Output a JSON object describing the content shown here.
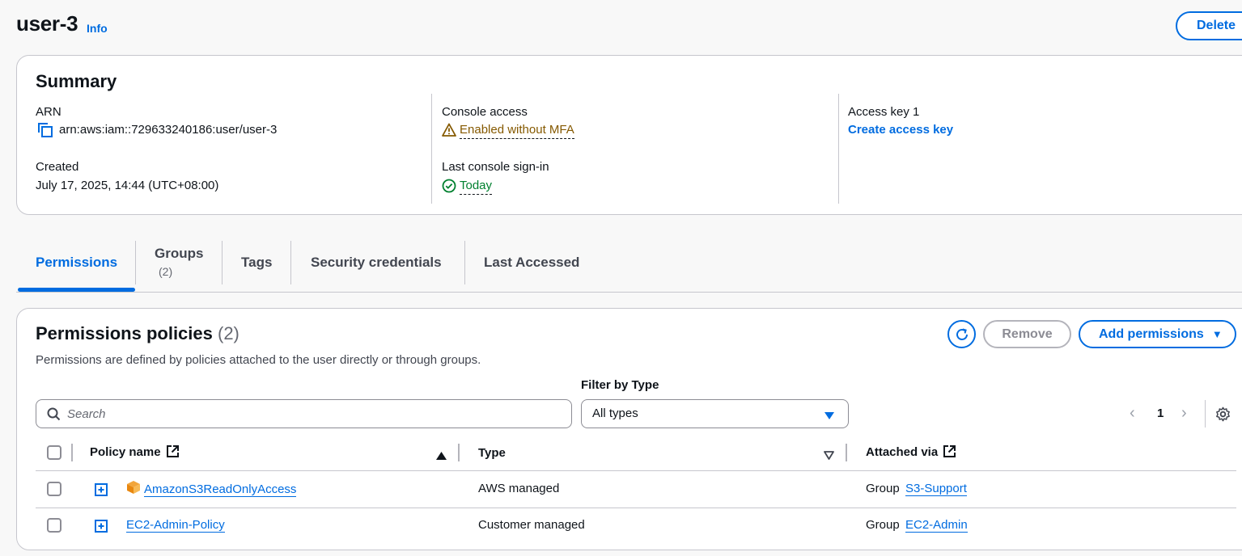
{
  "header": {
    "title": "user-3",
    "info_label": "Info",
    "delete_label": "Delete"
  },
  "summary": {
    "title": "Summary",
    "arn_label": "ARN",
    "arn_value": "arn:aws:iam::729633240186:user/user-3",
    "created_label": "Created",
    "created_value": "July 17, 2025, 14:44 (UTC+08:00)",
    "console_access_label": "Console access",
    "console_access_value": "Enabled without MFA",
    "last_signin_label": "Last console sign-in",
    "last_signin_value": "Today",
    "access_key_label": "Access key 1",
    "access_key_link": "Create access key"
  },
  "tabs": [
    {
      "label": "Permissions",
      "active": true
    },
    {
      "label": "Groups",
      "count": "(2)"
    },
    {
      "label": "Tags"
    },
    {
      "label": "Security credentials"
    },
    {
      "label": "Last Accessed"
    }
  ],
  "permissions": {
    "title": "Permissions policies",
    "count": "(2)",
    "description": "Permissions are defined by policies attached to the user directly or through groups.",
    "remove_label": "Remove",
    "add_label": "Add permissions",
    "filter_label": "Filter by Type",
    "search_placeholder": "Search",
    "filter_value": "All types",
    "page": "1",
    "columns": [
      "Policy name",
      "Type",
      "Attached via"
    ],
    "rows": [
      {
        "policy": "AmazonS3ReadOnlyAccess",
        "type": "AWS managed",
        "via_prefix": "Group",
        "via_link": "S3-Support"
      },
      {
        "policy": "EC2-Admin-Policy",
        "type": "Customer managed",
        "via_prefix": "Group",
        "via_link": "EC2-Admin"
      }
    ]
  },
  "colors": {
    "accent": "#006ce0",
    "warning": "#855900",
    "success": "#00802f"
  },
  "icons": {
    "copy": "copy-icon",
    "warning": "warning-icon",
    "success": "check-circle-icon",
    "refresh": "refresh-icon",
    "search": "search-icon",
    "caret": "caret-down-icon",
    "settings": "gear-icon",
    "external": "external-link-icon",
    "expand": "expand-plus-icon",
    "aws_managed": "aws-managed-policy-icon"
  }
}
